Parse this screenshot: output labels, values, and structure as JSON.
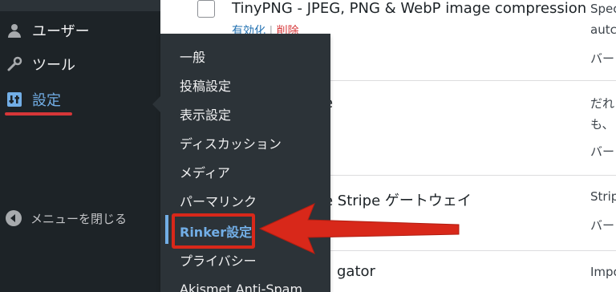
{
  "sidebar": {
    "items": [
      {
        "label": "ユーザー",
        "icon": "users-icon"
      },
      {
        "label": "ツール",
        "icon": "wrench-icon"
      },
      {
        "label": "設定",
        "icon": "settings-icon"
      }
    ],
    "collapse_label": "メニューを閉じる"
  },
  "submenu": {
    "items": [
      {
        "label": "一般"
      },
      {
        "label": "投稿設定"
      },
      {
        "label": "表示設定"
      },
      {
        "label": "ディスカッション"
      },
      {
        "label": "メディア"
      },
      {
        "label": "パーマリンク"
      },
      {
        "label": "Rinker設定"
      },
      {
        "label": "プライバシー"
      },
      {
        "label": "Akismet Anti-Spam"
      }
    ]
  },
  "plugins": [
    {
      "title": "TinyPNG - JPEG, PNG & WebP image compression",
      "actions": {
        "activate": "有効化",
        "sep": "|",
        "delete": "削除"
      },
      "desc_lines": [
        "Spec",
        "autc",
        "バー"
      ]
    },
    {
      "title": "e",
      "desc_lines": [
        "だれ",
        "も、",
        "バー"
      ]
    },
    {
      "title": "e Stripe ゲートウェイ",
      "desc_lines": [
        "Strip",
        "バー"
      ]
    },
    {
      "title": "gator",
      "desc_lines": [
        "Impo"
      ]
    }
  ],
  "colors": {
    "sidebar_bg": "#1d2327",
    "flyout_bg": "#2c3338",
    "accent_blue": "#72aee6",
    "annotation_red": "#d8281a"
  }
}
